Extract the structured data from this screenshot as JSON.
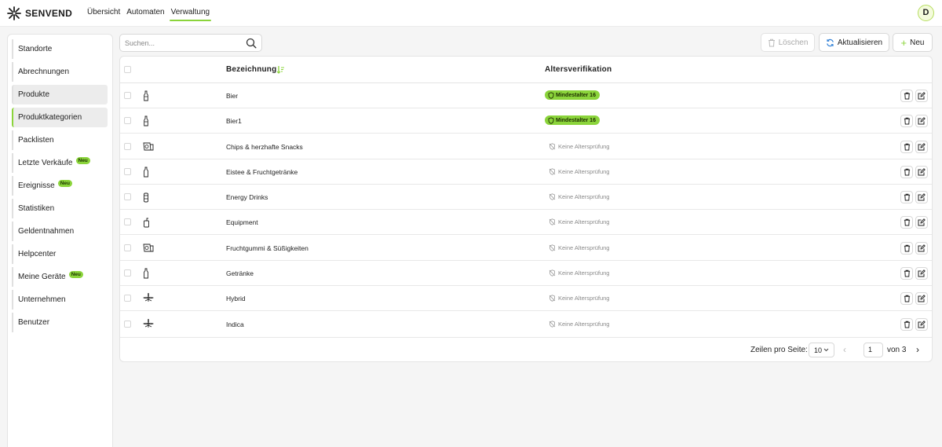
{
  "app": {
    "brand": "SENVEND",
    "nav": [
      "Übersicht",
      "Automaten",
      "Verwaltung"
    ],
    "active_nav": "Verwaltung",
    "user_initial": "D",
    "accent": "#8bd43b"
  },
  "sidebar": {
    "items": [
      {
        "label": "Standorte"
      },
      {
        "label": "Abrechnungen"
      },
      {
        "label": "Produkte"
      },
      {
        "label": "Produktkategorien"
      },
      {
        "label": "Packlisten"
      },
      {
        "label": "Letzte Verkäufe",
        "badge": "Neu"
      },
      {
        "label": "Ereignisse",
        "badge": "Neu"
      },
      {
        "label": "Statistiken"
      },
      {
        "label": "Geldentnahmen"
      },
      {
        "label": "Helpcenter"
      },
      {
        "label": "Meine Geräte",
        "badge": "Neu"
      },
      {
        "label": "Unternehmen"
      },
      {
        "label": "Benutzer"
      }
    ],
    "selected": "Produkte",
    "highlighted": "Produktkategorien"
  },
  "toolbar": {
    "search_placeholder": "Suchen...",
    "delete_label": "Löschen",
    "refresh_label": "Aktualisieren",
    "new_label": "Neu"
  },
  "table": {
    "columns": [
      "Bezeichnung",
      "Altersverifikation"
    ],
    "rows": [
      {
        "name": "Bier",
        "icon": "beer-bottle-icon",
        "age": "Mindestalter 16",
        "verified": true
      },
      {
        "name": "Bier1",
        "icon": "beer-bottle-icon",
        "age": "Mindestalter 16",
        "verified": true
      },
      {
        "name": "Chips & herzhafte Snacks",
        "icon": "snack-bag-icon",
        "age": "Keine Altersprüfung",
        "verified": false
      },
      {
        "name": "Eistee & Fruchtgetränke",
        "icon": "bottle-icon",
        "age": "Keine Altersprüfung",
        "verified": false
      },
      {
        "name": "Energy Drinks",
        "icon": "can-icon",
        "age": "Keine Altersprüfung",
        "verified": false
      },
      {
        "name": "Equipment",
        "icon": "lighter-icon",
        "age": "Keine Altersprüfung",
        "verified": false
      },
      {
        "name": "Fruchtgummi & Süßigkeiten",
        "icon": "snack-bag-icon",
        "age": "Keine Altersprüfung",
        "verified": false
      },
      {
        "name": "Getränke",
        "icon": "bottle-icon",
        "age": "Keine Altersprüfung",
        "verified": false
      },
      {
        "name": "Hybrid",
        "icon": "leaf-icon",
        "age": "Keine Altersprüfung",
        "verified": false
      },
      {
        "name": "Indica",
        "icon": "leaf-icon",
        "age": "Keine Altersprüfung",
        "verified": false
      }
    ]
  },
  "pagination": {
    "rows_per_page_label": "Zeilen pro Seite:",
    "rows_per_page": "10",
    "page": "1",
    "of_label": "von 3"
  }
}
